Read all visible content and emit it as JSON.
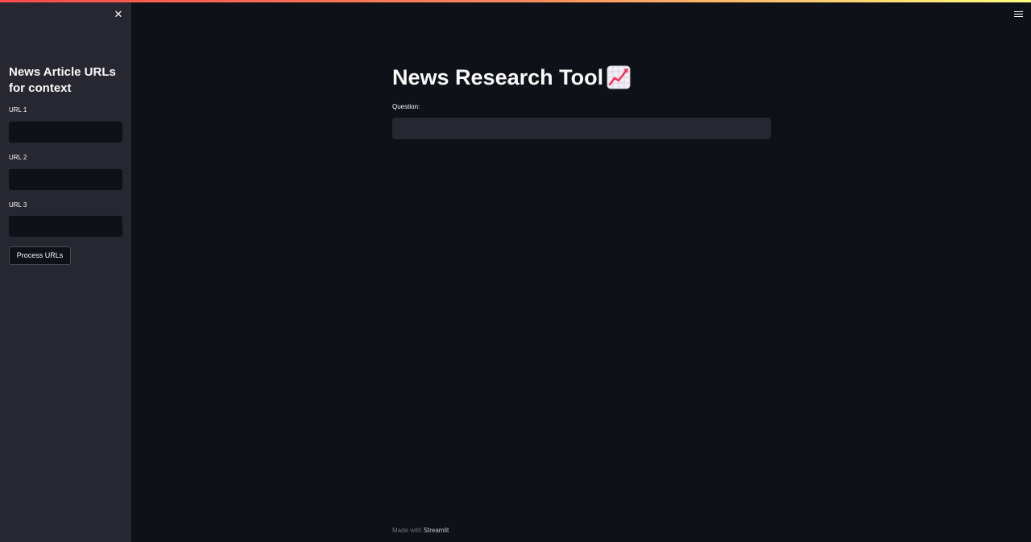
{
  "sidebar": {
    "title": "News Article URLs for context",
    "close_icon_glyph": "✕",
    "fields": [
      {
        "label": "URL 1",
        "value": ""
      },
      {
        "label": "URL 2",
        "value": ""
      },
      {
        "label": "URL 3",
        "value": ""
      }
    ],
    "process_button_label": "Process URLs"
  },
  "main": {
    "title": "News Research Tool",
    "title_icon": "chart-increasing-icon",
    "question_label": "Question:",
    "question_value": ""
  },
  "footer": {
    "prefix": "Made with ",
    "link_text": "Streamlit"
  },
  "colors": {
    "background": "#0e1117",
    "sidebar_background": "#262730",
    "text": "#fafafa",
    "accent": "#ff4b4b"
  }
}
